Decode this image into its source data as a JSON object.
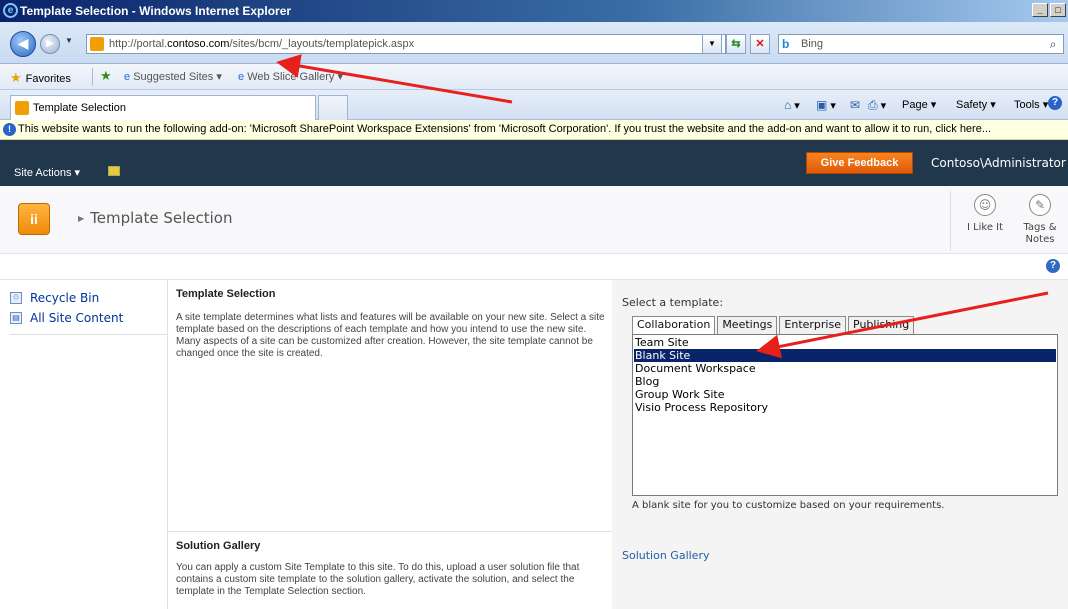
{
  "browser": {
    "window_title": "Template Selection - Windows Internet Explorer",
    "url_host_prefix": "http://portal.",
    "url_host": "contoso.com",
    "url_path": "/sites/bcm/_layouts/templatepick.aspx",
    "search_placeholder": "Bing",
    "favorites_label": "Favorites",
    "suggested_sites": "Suggested Sites ▾",
    "web_slice_gallery": "Web Slice Gallery ▾",
    "tab_title": "Template Selection",
    "commands": {
      "page": "Page ▾",
      "safety": "Safety ▾",
      "tools": "Tools ▾"
    },
    "info_bar": "This website wants to run the following add-on: 'Microsoft SharePoint Workspace Extensions' from 'Microsoft Corporation'. If you trust the website and the add-on and want to allow it to run, click here..."
  },
  "sharepoint": {
    "site_actions": "Site Actions ▾",
    "give_feedback": "Give Feedback",
    "user": "Contoso\\Administrator",
    "breadcrumb": "Template Selection",
    "i_like_it": "I Like It",
    "tags_notes_1": "Tags &",
    "tags_notes_2": "Notes",
    "left_nav": [
      {
        "label": "Recycle Bin"
      },
      {
        "label": "All Site Content"
      }
    ]
  },
  "template_section": {
    "title": "Template Selection",
    "description": "A site template determines what lists and features will be available on your new site. Select a site template based on the descriptions of each template and how you intend to use the new site. Many aspects of a site can be customized after creation. However, the site template cannot be changed once the site is created.",
    "select_label": "Select a template:",
    "tabs": [
      "Collaboration",
      "Meetings",
      "Enterprise",
      "Publishing"
    ],
    "active_tab": "Collaboration",
    "templates": [
      "Team Site",
      "Blank Site",
      "Document Workspace",
      "Blog",
      "Group Work Site",
      "Visio Process Repository"
    ],
    "selected_template": "Blank Site",
    "selected_description": "A blank site for you to customize based on your requirements."
  },
  "solution_section": {
    "title": "Solution Gallery",
    "description": "You can apply a custom Site Template to this site. To do this, upload a user solution file that contains a custom site template to the solution gallery, activate the solution, and select the template in the Template Selection section.",
    "link": "Solution Gallery"
  },
  "colors": {
    "ribbon": "#21374c",
    "feedback": "#f26d12",
    "selection": "#0a246a",
    "annotation_arrow": "#e8201c"
  }
}
